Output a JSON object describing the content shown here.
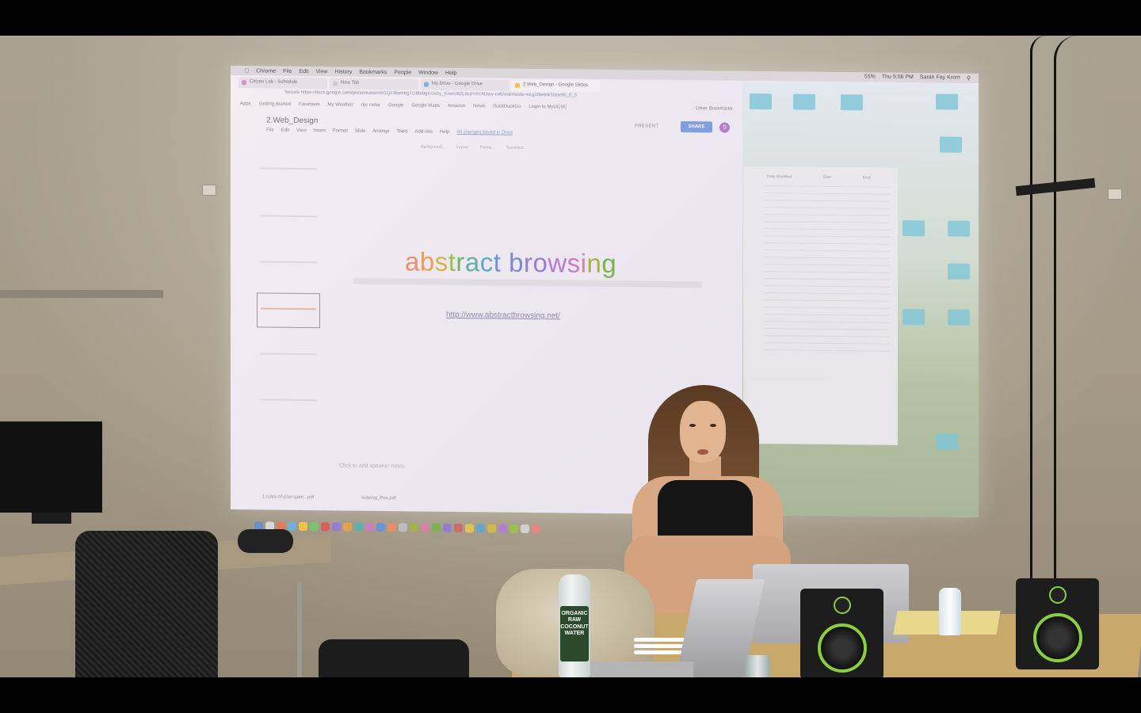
{
  "mac_menu": {
    "items": [
      "Chrome",
      "File",
      "Edit",
      "View",
      "History",
      "Bookmarks",
      "People",
      "Window",
      "Help"
    ],
    "battery": "55%",
    "clock": "Thu 5:56 PM",
    "user": "Sarah Fay Krom"
  },
  "browser": {
    "tabs": [
      {
        "label": "Citizen Lab - Schedule",
        "color": "#d98bd0"
      },
      {
        "label": "New Tab",
        "color": "#cccccc"
      },
      {
        "label": "My Drive - Google Drive",
        "color": "#7fb2e0"
      },
      {
        "label": "2.Web_Design - Google Slides",
        "color": "#f0c24a"
      }
    ],
    "address": "Secure  https://docs.google.com/presentation/d/1QF9befrbgTG8bl0gs7nd/y_KnwU82L8c0YAYADew-c46/edit#slide=id.g1fbeb9/1bbe9b_0_5",
    "bookmarks": [
      "Apps",
      "Getting Started",
      "Facebook",
      "My Weather",
      "npr radar",
      "Google",
      "Google Maps",
      "Amazon",
      "News",
      "DuckDuckGo",
      "Login to MyUCSC"
    ],
    "other_bookmarks": "Other Bookmarks"
  },
  "slides_app": {
    "doc_title": "2.Web_Design",
    "menu": [
      "File",
      "Edit",
      "View",
      "Insert",
      "Format",
      "Slide",
      "Arrange",
      "Tools",
      "Add-ons",
      "Help"
    ],
    "saved_status": "All changes saved in Drive",
    "present_label": "PRESENT",
    "share_label": "SHARE",
    "avatar_letter": "S",
    "toolbar": [
      "Background...",
      "Layout",
      "Theme...",
      "Transition..."
    ],
    "slide_title_letters": [
      {
        "ch": "a",
        "color": "#e88f6a"
      },
      {
        "ch": "b",
        "color": "#e5a054"
      },
      {
        "ch": "s",
        "color": "#d4b34a"
      },
      {
        "ch": "t",
        "color": "#9bbf52"
      },
      {
        "ch": "r",
        "color": "#6eb56a"
      },
      {
        "ch": "a",
        "color": "#5fb0a6"
      },
      {
        "ch": "c",
        "color": "#63a6c9"
      },
      {
        "ch": "t",
        "color": "#6e93d4"
      },
      {
        "ch": " ",
        "color": "#000000"
      },
      {
        "ch": "b",
        "color": "#7e87cf"
      },
      {
        "ch": "r",
        "color": "#8f7fcf"
      },
      {
        "ch": "o",
        "color": "#a07ad0"
      },
      {
        "ch": "w",
        "color": "#b47ed0"
      },
      {
        "ch": "s",
        "color": "#c77fbf"
      },
      {
        "ch": "i",
        "color": "#d682a6"
      },
      {
        "ch": "n",
        "color": "#a6b04c"
      },
      {
        "ch": "g",
        "color": "#79b54e"
      }
    ],
    "slide_link": "http://www.abstractbrowsing.net/",
    "speaker_notes": "Click to add speaker notes",
    "downloads": [
      "1 rules-of-plan-gam...pdf",
      "kobring_Pos.pdf"
    ]
  },
  "finder": {
    "columns": [
      "Date Modified",
      "Size",
      "Kind"
    ]
  },
  "bottle_label": "ORGANIC RAW COCONUT WATER",
  "colors": {
    "speaker_accent": "#8bcf3f",
    "share_button": "#7f9fe0",
    "avatar": "#b07fd0"
  }
}
